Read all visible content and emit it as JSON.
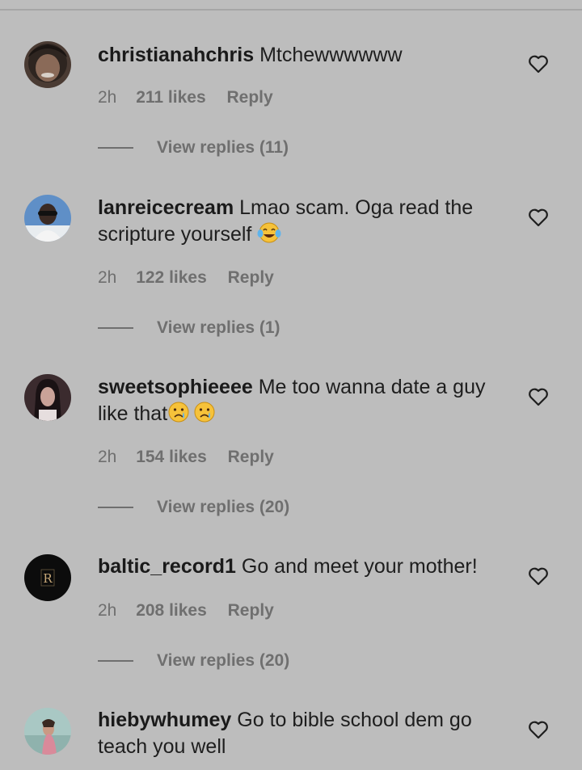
{
  "comments": [
    {
      "username": "christianahchris",
      "text": "Mtchewwwwww",
      "time": "2h",
      "likes": "211 likes",
      "reply": "Reply",
      "replies": "View replies (11)"
    },
    {
      "username": "lanreicecream",
      "text": "Lmao scam. Oga read the scripture yourself",
      "emoji": "😂",
      "time": "2h",
      "likes": "122 likes",
      "reply": "Reply",
      "replies": "View replies (1)"
    },
    {
      "username": "sweetsophieeee",
      "text": "Me too wanna date a guy like that",
      "emoji": "😢😢",
      "time": "2h",
      "likes": "154 likes",
      "reply": "Reply",
      "replies": "View replies (20)"
    },
    {
      "username": "baltic_record1",
      "text": "Go and meet your mother!",
      "time": "2h",
      "likes": "208 likes",
      "reply": "Reply",
      "replies": "View replies (20)",
      "avatar_letter": "R"
    },
    {
      "username": "hiebywhumey",
      "text": "Go to bible school dem go teach you well"
    }
  ],
  "icons": {
    "heart": "heart-outline-icon",
    "emoji_laugh": "face-with-tears-of-joy",
    "emoji_cry": "crying-face"
  },
  "colors": {
    "background": "#bdbdbd",
    "text": "#1e1e1e",
    "meta": "#6f6f6f"
  }
}
